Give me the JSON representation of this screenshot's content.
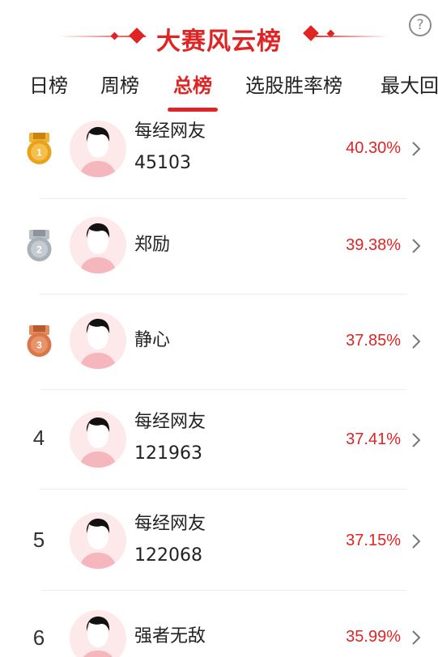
{
  "header": {
    "title": "大赛风云榜",
    "help_label": "?"
  },
  "tabs": [
    {
      "label": "日榜",
      "active": false
    },
    {
      "label": "周榜",
      "active": false
    },
    {
      "label": "总榜",
      "active": true
    },
    {
      "label": "选股胜率榜",
      "active": false
    },
    {
      "label": "最大回",
      "active": false
    }
  ],
  "ranking": [
    {
      "rank": "1",
      "badge": "gold-medal",
      "name_line1": "每经网友",
      "name_line2": "45103",
      "percent": "40.30%"
    },
    {
      "rank": "2",
      "badge": "silver-medal",
      "name_line1": "郑励",
      "name_line2": "",
      "percent": "39.38%"
    },
    {
      "rank": "3",
      "badge": "bronze-medal",
      "name_line1": "静心",
      "name_line2": "",
      "percent": "37.85%"
    },
    {
      "rank": "4",
      "badge": "",
      "name_line1": "每经网友",
      "name_line2": "121963",
      "percent": "37.41%"
    },
    {
      "rank": "5",
      "badge": "",
      "name_line1": "每经网友",
      "name_line2": "122068",
      "percent": "37.15%"
    },
    {
      "rank": "6",
      "badge": "",
      "name_line1": "强者无敌",
      "name_line2": "",
      "percent": "35.99%"
    }
  ],
  "colors": {
    "accent": "#e02424",
    "gold": "#e9a21a",
    "silver": "#a8b0b8",
    "bronze": "#d9774a",
    "avatar_bg": "#fde8ea"
  }
}
